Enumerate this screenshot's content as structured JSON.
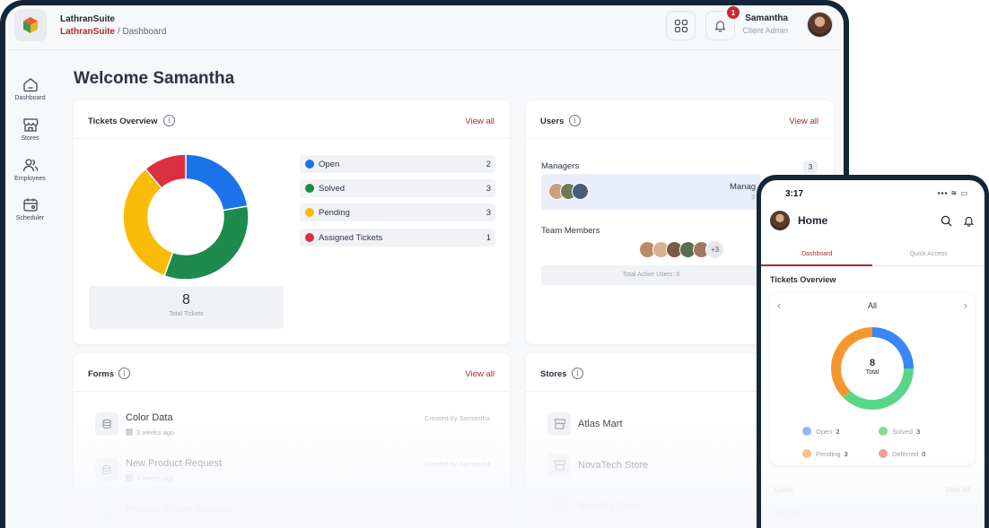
{
  "app": {
    "name": "LathranSuite",
    "breadcrumb_root": "LathranSuite",
    "breadcrumb_sep": "/",
    "breadcrumb_page": "Dashboard"
  },
  "header": {
    "notification_count": "1",
    "user_name": "Samantha",
    "user_role": "Client Admin"
  },
  "sidebar": {
    "items": [
      {
        "label": "Dashboard",
        "icon": "home-icon"
      },
      {
        "label": "Stores",
        "icon": "store-icon"
      },
      {
        "label": "Employees",
        "icon": "users-icon"
      },
      {
        "label": "Scheduler",
        "icon": "calendar-icon"
      }
    ]
  },
  "welcome": "Welcome Samantha",
  "tickets": {
    "title": "Tickets Overview",
    "view_all": "View all",
    "legend": [
      {
        "label": "Open",
        "count": "2",
        "color": "#1a73e8"
      },
      {
        "label": "Solved",
        "count": "3",
        "color": "#1e8a4c"
      },
      {
        "label": "Pending",
        "count": "3",
        "color": "#f9bc06"
      },
      {
        "label": "Assigned Tickets",
        "count": "1",
        "color": "#dc3040"
      }
    ],
    "total": "8",
    "total_label": "Total Tickets"
  },
  "chart_data": {
    "type": "pie",
    "title": "",
    "categories": [
      "Open",
      "Solved",
      "Pending",
      "Assigned Tickets"
    ],
    "values": [
      2,
      3,
      3,
      1
    ],
    "colors": [
      "#1a73e8",
      "#1e8a4c",
      "#f9bc06",
      "#dc3040"
    ],
    "donut": true,
    "center_label": ""
  },
  "users": {
    "title": "Users",
    "view_all": "View all",
    "managers_label": "Managers",
    "managers_count": "3",
    "managers_box_text": "Manag",
    "managers_box_sub": "3",
    "team_label": "Team Members",
    "team_more": "+3",
    "active_label": "Total Active Users: 8"
  },
  "forms": {
    "title": "Forms",
    "view_all": "View all",
    "items": [
      {
        "name": "Color Data",
        "meta": "3 weeks ago",
        "by": "Created by Samantha"
      },
      {
        "name": "New Product Request",
        "meta": "4 weeks ago",
        "by": "Created by Samantha"
      },
      {
        "name": "Product Return Request",
        "meta": "",
        "by": ""
      }
    ]
  },
  "stores": {
    "title": "Stores",
    "items": [
      {
        "name": "Atlas Mart"
      },
      {
        "name": "NovaTech Store"
      },
      {
        "name": "BlueSky Shop"
      }
    ]
  },
  "phone": {
    "time": "3:17",
    "status": "▪▪▪ ≋ ▭",
    "title": "Home",
    "tabs": [
      "Dashboard",
      "Quick Access"
    ],
    "section": "Tickets Overview",
    "filter": "All",
    "total": "8",
    "total_label": "Total",
    "legend": [
      {
        "label": "Open",
        "count": "2",
        "color": "#8db8f5"
      },
      {
        "label": "Solved",
        "count": "3",
        "color": "#7fdc9b"
      },
      {
        "label": "Pending",
        "count": "3",
        "color": "#f8c28a"
      },
      {
        "label": "Deferred",
        "count": "0",
        "color": "#f49a9a"
      }
    ],
    "ring": [
      {
        "label": "Open",
        "value": 2,
        "color": "#3a86f5"
      },
      {
        "label": "Solved",
        "value": 3,
        "color": "#5ad68a"
      },
      {
        "label": "Pending",
        "value": 3,
        "color": "#f7962f"
      }
    ],
    "users_label": "Users",
    "users_view_all": "View All",
    "managers_label": "Managers",
    "managers_count": "3"
  }
}
